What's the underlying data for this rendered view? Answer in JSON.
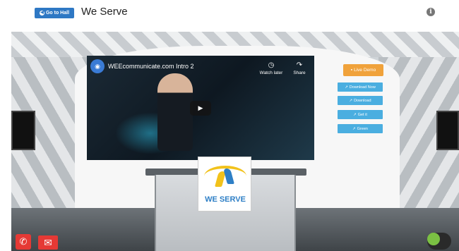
{
  "header": {
    "go_to_hall": "Go to Hall",
    "title": "We Serve"
  },
  "video": {
    "title": "WEEcommunicate.com Intro 2",
    "watch_later": "Watch later",
    "share": "Share"
  },
  "buttons": {
    "live_demo": "Live Demo",
    "download_now": "Download Now",
    "download": "Download",
    "get_it": "Get it",
    "green": "Green"
  },
  "logo": {
    "text": "WE SERVE"
  },
  "colors": {
    "primary": "#2e78c4",
    "live_demo": "#f0a23b",
    "side_buttons": "#4aaee0",
    "contact": "#e53935",
    "chat": "#7bc043"
  },
  "icons": {
    "hall": "arrow-circle-left",
    "info": "info-circle",
    "phone": "phone",
    "mail": "envelope",
    "chat": "chat-bubble"
  }
}
